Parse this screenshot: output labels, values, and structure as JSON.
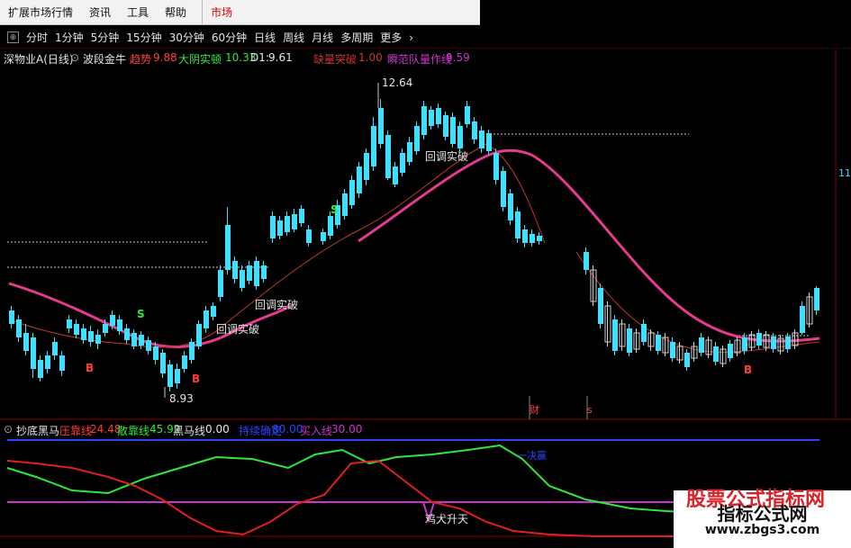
{
  "menubar": {
    "items": [
      "扩展市场行情",
      "资讯",
      "工具",
      "帮助"
    ],
    "active": "市场"
  },
  "periodbar": {
    "items": [
      "分时",
      "1分钟",
      "5分钟",
      "15分钟",
      "30分钟",
      "60分钟",
      "日线",
      "周线",
      "月线",
      "多周期",
      "更多"
    ]
  },
  "main_indicator": {
    "title": "深物业A(日线)",
    "name": "波段金牛",
    "trend_label": "趋势",
    "trend_value": "9.88",
    "yang_label": "大阴实顿",
    "yang_value": "10.33",
    "d1_label": "D1:",
    "d1_value": "9.61",
    "break_label": "缺量突破",
    "break_value": "1.00",
    "zhuang_label": "瞬范队量作线",
    "zhuang_value": "9.59"
  },
  "chart_labels": {
    "high": "12.64",
    "low": "8.93",
    "pullback1": "回调实破",
    "pullback2": "回调实破",
    "pullback3": "回调实破",
    "s1": "S",
    "s2": "S",
    "b1": "B",
    "b2": "B",
    "b3": "B",
    "right_edge": "11",
    "cai": "财",
    "s_mark": "s"
  },
  "sub_indicator": {
    "name": "抄底黑马",
    "l1_label": "压靠线",
    "l1_value": "24.48",
    "l2_label": "散靠线",
    "l2_value": "45.92",
    "l3_label": "黑马线",
    "l3_value": "0.00",
    "l4_label": "持续确定",
    "l4_value": "80.00",
    "l5_label": "买入线",
    "l5_value": "30.00",
    "annot": "鸡犬升天",
    "annot2": "一决赢"
  },
  "watermark": {
    "top": "股票公式指标网",
    "mid": "指标公式网",
    "url": "www.zbgs3.com"
  },
  "colors": {
    "up": "#ff3b3b",
    "down": "#3fe0ff",
    "ma": "#e23b8f",
    "green": "#2ee83a",
    "red": "#e02020",
    "magenta": "#cc33cc",
    "blue": "#2a44ff"
  }
}
